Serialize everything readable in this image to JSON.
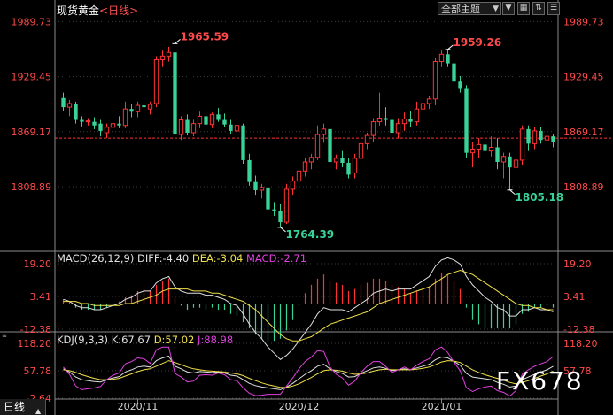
{
  "header": {
    "instrument": "现货黄金",
    "period": "<日线>",
    "theme_label": "全部主题",
    "tool_icons": [
      "chevron-down-icon",
      "grid-icon",
      "swap-icon",
      "menu-icon"
    ]
  },
  "price_panel": {
    "y_ticks": [
      "1989.73",
      "1929.45",
      "1869.17",
      "1808.89"
    ],
    "annotations": {
      "high1": "1965.59",
      "low1": "1764.39",
      "high2": "1959.26",
      "low2": "1805.18"
    }
  },
  "macd": {
    "label_name": "MACD(26,12,9)",
    "diff_label": "DIFF:-4.40",
    "dea_label": "DEA:-3.04",
    "macd_label": "MACD:-2.71",
    "y_ticks": [
      "19.20",
      "3.41",
      "-12.38"
    ]
  },
  "kdj": {
    "label_name": "KDJ(9,3,3)",
    "k_label": "K:67.67",
    "d_label": "D:57.02",
    "j_label": "J:88.98",
    "y_ticks": [
      "118.20",
      "57.78",
      "-2.64"
    ]
  },
  "x_axis": {
    "labels": [
      "2020/11",
      "2020/12",
      "2021/01"
    ]
  },
  "bottom_tab": {
    "label": "日线"
  },
  "watermark": {
    "text": "FX678"
  },
  "unit_note": "≈",
  "colors": {
    "up": "#ff3232",
    "down": "#39d39a",
    "price_ref": "#ff3232",
    "diff": "#e0e0e0",
    "dea": "#f0e04a",
    "j_line": "#e040e0"
  },
  "chart_data": {
    "type": "candlestick",
    "title": "",
    "ylim": [
      1740,
      1995
    ],
    "reference_price": 1862,
    "candles": [
      {
        "o": 1906,
        "h": 1912,
        "l": 1892,
        "c": 1896
      },
      {
        "o": 1896,
        "h": 1904,
        "l": 1886,
        "c": 1900
      },
      {
        "o": 1900,
        "h": 1902,
        "l": 1878,
        "c": 1882
      },
      {
        "o": 1882,
        "h": 1886,
        "l": 1875,
        "c": 1880
      },
      {
        "o": 1880,
        "h": 1884,
        "l": 1876,
        "c": 1881
      },
      {
        "o": 1880,
        "h": 1885,
        "l": 1872,
        "c": 1876
      },
      {
        "o": 1878,
        "h": 1882,
        "l": 1864,
        "c": 1870
      },
      {
        "o": 1868,
        "h": 1878,
        "l": 1862,
        "c": 1874
      },
      {
        "o": 1874,
        "h": 1883,
        "l": 1870,
        "c": 1878
      },
      {
        "o": 1878,
        "h": 1886,
        "l": 1873,
        "c": 1876
      },
      {
        "o": 1876,
        "h": 1902,
        "l": 1873,
        "c": 1894
      },
      {
        "o": 1894,
        "h": 1900,
        "l": 1885,
        "c": 1891
      },
      {
        "o": 1891,
        "h": 1902,
        "l": 1885,
        "c": 1898
      },
      {
        "o": 1898,
        "h": 1915,
        "l": 1890,
        "c": 1896
      },
      {
        "o": 1894,
        "h": 1902,
        "l": 1888,
        "c": 1899
      },
      {
        "o": 1900,
        "h": 1952,
        "l": 1896,
        "c": 1948
      },
      {
        "o": 1948,
        "h": 1958,
        "l": 1940,
        "c": 1952
      },
      {
        "o": 1952,
        "h": 1962,
        "l": 1946,
        "c": 1956
      },
      {
        "o": 1956,
        "h": 1965,
        "l": 1858,
        "c": 1866
      },
      {
        "o": 1866,
        "h": 1886,
        "l": 1860,
        "c": 1882
      },
      {
        "o": 1882,
        "h": 1888,
        "l": 1865,
        "c": 1868
      },
      {
        "o": 1868,
        "h": 1882,
        "l": 1864,
        "c": 1878
      },
      {
        "o": 1878,
        "h": 1891,
        "l": 1873,
        "c": 1886
      },
      {
        "o": 1886,
        "h": 1892,
        "l": 1875,
        "c": 1877
      },
      {
        "o": 1877,
        "h": 1890,
        "l": 1873,
        "c": 1888
      },
      {
        "o": 1888,
        "h": 1895,
        "l": 1880,
        "c": 1882
      },
      {
        "o": 1882,
        "h": 1889,
        "l": 1874,
        "c": 1877
      },
      {
        "o": 1877,
        "h": 1882,
        "l": 1866,
        "c": 1870
      },
      {
        "o": 1870,
        "h": 1880,
        "l": 1863,
        "c": 1876
      },
      {
        "o": 1876,
        "h": 1878,
        "l": 1834,
        "c": 1838
      },
      {
        "o": 1838,
        "h": 1845,
        "l": 1810,
        "c": 1814
      },
      {
        "o": 1814,
        "h": 1821,
        "l": 1800,
        "c": 1805
      },
      {
        "o": 1805,
        "h": 1812,
        "l": 1796,
        "c": 1808
      },
      {
        "o": 1808,
        "h": 1816,
        "l": 1780,
        "c": 1784
      },
      {
        "o": 1784,
        "h": 1792,
        "l": 1777,
        "c": 1782
      },
      {
        "o": 1782,
        "h": 1790,
        "l": 1764,
        "c": 1770
      },
      {
        "o": 1770,
        "h": 1812,
        "l": 1768,
        "c": 1806
      },
      {
        "o": 1806,
        "h": 1820,
        "l": 1800,
        "c": 1815
      },
      {
        "o": 1815,
        "h": 1830,
        "l": 1808,
        "c": 1826
      },
      {
        "o": 1826,
        "h": 1841,
        "l": 1820,
        "c": 1836
      },
      {
        "o": 1836,
        "h": 1845,
        "l": 1828,
        "c": 1841
      },
      {
        "o": 1841,
        "h": 1876,
        "l": 1838,
        "c": 1866
      },
      {
        "o": 1866,
        "h": 1878,
        "l": 1857,
        "c": 1872
      },
      {
        "o": 1872,
        "h": 1880,
        "l": 1830,
        "c": 1836
      },
      {
        "o": 1836,
        "h": 1844,
        "l": 1828,
        "c": 1840
      },
      {
        "o": 1840,
        "h": 1848,
        "l": 1830,
        "c": 1835
      },
      {
        "o": 1835,
        "h": 1840,
        "l": 1818,
        "c": 1822
      },
      {
        "o": 1824,
        "h": 1845,
        "l": 1818,
        "c": 1840
      },
      {
        "o": 1840,
        "h": 1860,
        "l": 1835,
        "c": 1856
      },
      {
        "o": 1856,
        "h": 1868,
        "l": 1850,
        "c": 1865
      },
      {
        "o": 1865,
        "h": 1884,
        "l": 1858,
        "c": 1880
      },
      {
        "o": 1880,
        "h": 1912,
        "l": 1876,
        "c": 1884
      },
      {
        "o": 1884,
        "h": 1896,
        "l": 1876,
        "c": 1882
      },
      {
        "o": 1882,
        "h": 1890,
        "l": 1860,
        "c": 1868
      },
      {
        "o": 1868,
        "h": 1884,
        "l": 1862,
        "c": 1878
      },
      {
        "o": 1878,
        "h": 1890,
        "l": 1870,
        "c": 1883
      },
      {
        "o": 1883,
        "h": 1892,
        "l": 1874,
        "c": 1880
      },
      {
        "o": 1880,
        "h": 1902,
        "l": 1876,
        "c": 1894
      },
      {
        "o": 1894,
        "h": 1904,
        "l": 1885,
        "c": 1900
      },
      {
        "o": 1900,
        "h": 1908,
        "l": 1894,
        "c": 1905
      },
      {
        "o": 1905,
        "h": 1950,
        "l": 1898,
        "c": 1946
      },
      {
        "o": 1946,
        "h": 1958,
        "l": 1940,
        "c": 1954
      },
      {
        "o": 1954,
        "h": 1959,
        "l": 1940,
        "c": 1944
      },
      {
        "o": 1944,
        "h": 1950,
        "l": 1920,
        "c": 1924
      },
      {
        "o": 1924,
        "h": 1930,
        "l": 1912,
        "c": 1916
      },
      {
        "o": 1916,
        "h": 1920,
        "l": 1840,
        "c": 1846
      },
      {
        "o": 1846,
        "h": 1858,
        "l": 1830,
        "c": 1850
      },
      {
        "o": 1850,
        "h": 1862,
        "l": 1840,
        "c": 1855
      },
      {
        "o": 1855,
        "h": 1860,
        "l": 1840,
        "c": 1848
      },
      {
        "o": 1848,
        "h": 1864,
        "l": 1842,
        "c": 1852
      },
      {
        "o": 1852,
        "h": 1862,
        "l": 1828,
        "c": 1836
      },
      {
        "o": 1836,
        "h": 1846,
        "l": 1818,
        "c": 1842
      },
      {
        "o": 1842,
        "h": 1846,
        "l": 1805,
        "c": 1830
      },
      {
        "o": 1830,
        "h": 1846,
        "l": 1822,
        "c": 1838
      },
      {
        "o": 1838,
        "h": 1876,
        "l": 1832,
        "c": 1872
      },
      {
        "o": 1872,
        "h": 1876,
        "l": 1848,
        "c": 1856
      },
      {
        "o": 1856,
        "h": 1874,
        "l": 1850,
        "c": 1870
      },
      {
        "o": 1870,
        "h": 1874,
        "l": 1856,
        "c": 1860
      },
      {
        "o": 1860,
        "h": 1868,
        "l": 1852,
        "c": 1864
      },
      {
        "o": 1864,
        "h": 1866,
        "l": 1852,
        "c": 1858
      }
    ],
    "macd_series": {
      "diff": [
        2,
        1,
        -1,
        -2,
        -2,
        -3,
        -3,
        -2,
        -1,
        0,
        2,
        3,
        5,
        6,
        6,
        10,
        12,
        13,
        8,
        6,
        5,
        5,
        5,
        4,
        4,
        3,
        2,
        0,
        -1,
        -5,
        -10,
        -14,
        -17,
        -21,
        -24,
        -27,
        -25,
        -22,
        -18,
        -14,
        -10,
        -5,
        -2,
        -3,
        -3,
        -3,
        -4,
        -2,
        0,
        2,
        5,
        6,
        7,
        6,
        7,
        7,
        7,
        9,
        11,
        13,
        18,
        21,
        22,
        21,
        19,
        13,
        9,
        6,
        3,
        1,
        -2,
        -3,
        -6,
        -6,
        -3,
        -3,
        -2,
        -3,
        -3,
        -4
      ],
      "dea": [
        1,
        1,
        1,
        0,
        0,
        -1,
        -1,
        -1,
        -1,
        -1,
        0,
        0,
        1,
        2,
        3,
        4,
        6,
        7,
        7,
        7,
        7,
        6,
        6,
        6,
        5,
        5,
        4,
        3,
        2,
        1,
        -1,
        -3,
        -6,
        -9,
        -12,
        -15,
        -17,
        -18,
        -18,
        -17,
        -16,
        -14,
        -12,
        -10,
        -9,
        -8,
        -7,
        -6,
        -5,
        -4,
        -2,
        0,
        1,
        2,
        3,
        4,
        5,
        6,
        7,
        8,
        10,
        12,
        14,
        15,
        16,
        15,
        14,
        12,
        10,
        8,
        6,
        4,
        2,
        0,
        -1,
        -1,
        -2,
        -2,
        -3,
        -3
      ],
      "hist": [
        2,
        1,
        -2,
        -3,
        -3,
        -3,
        -3,
        -2,
        -1,
        1,
        3,
        4,
        6,
        7,
        6,
        9,
        11,
        12,
        3,
        -1,
        -3,
        -2,
        -2,
        -3,
        -2,
        -3,
        -3,
        -5,
        -6,
        -9,
        -12,
        -15,
        -17,
        -19,
        -18,
        -17,
        -13,
        -8,
        -1,
        5,
        9,
        12,
        14,
        11,
        10,
        9,
        6,
        7,
        9,
        10,
        12,
        12,
        11,
        9,
        8,
        7,
        5,
        6,
        7,
        8,
        12,
        15,
        14,
        11,
        7,
        -2,
        -8,
        -10,
        -12,
        -12,
        -12,
        -12,
        -12,
        -10,
        -5,
        -4,
        -2,
        -2,
        -1,
        -2
      ]
    },
    "kdj_series": {
      "k": [
        62,
        55,
        44,
        38,
        36,
        34,
        33,
        38,
        42,
        45,
        55,
        60,
        66,
        68,
        66,
        80,
        86,
        90,
        68,
        62,
        55,
        53,
        56,
        55,
        54,
        55,
        53,
        48,
        46,
        38,
        30,
        25,
        22,
        20,
        18,
        16,
        22,
        30,
        40,
        50,
        58,
        68,
        72,
        62,
        56,
        52,
        44,
        45,
        52,
        58,
        64,
        66,
        63,
        58,
        60,
        62,
        60,
        64,
        68,
        72,
        82,
        88,
        86,
        78,
        70,
        52,
        44,
        42,
        40,
        38,
        32,
        28,
        22,
        24,
        38,
        44,
        50,
        55,
        60,
        67.67
      ],
      "d": [
        60,
        58,
        54,
        49,
        45,
        41,
        38,
        38,
        39,
        41,
        46,
        51,
        56,
        60,
        62,
        68,
        74,
        80,
        76,
        71,
        66,
        62,
        60,
        58,
        57,
        56,
        55,
        53,
        51,
        47,
        41,
        36,
        31,
        27,
        24,
        21,
        21,
        24,
        29,
        36,
        43,
        51,
        58,
        60,
        59,
        57,
        53,
        50,
        51,
        53,
        57,
        60,
        61,
        60,
        60,
        60,
        60,
        61,
        63,
        66,
        71,
        77,
        80,
        79,
        76,
        68,
        60,
        54,
        49,
        45,
        41,
        37,
        32,
        29,
        32,
        36,
        41,
        46,
        51,
        57.02
      ],
      "j": [
        66,
        50,
        24,
        16,
        18,
        20,
        23,
        38,
        48,
        53,
        73,
        78,
        86,
        84,
        74,
        104,
        110,
        110,
        52,
        44,
        33,
        35,
        48,
        49,
        48,
        53,
        49,
        38,
        36,
        20,
        8,
        3,
        4,
        6,
        6,
        6,
        24,
        42,
        62,
        78,
        88,
        102,
        100,
        66,
        50,
        42,
        26,
        35,
        54,
        68,
        78,
        78,
        67,
        54,
        60,
        66,
        60,
        70,
        78,
        84,
        104,
        110,
        98,
        76,
        58,
        20,
        12,
        18,
        22,
        24,
        14,
        10,
        2,
        14,
        50,
        60,
        68,
        73,
        78,
        88.98
      ]
    }
  }
}
